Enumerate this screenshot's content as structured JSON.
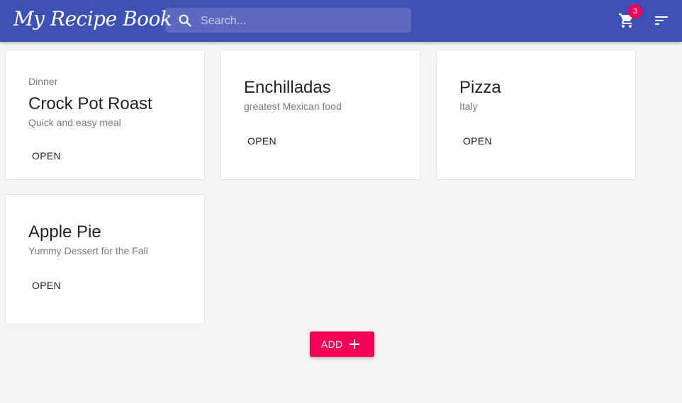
{
  "appbar": {
    "title": "My Recipe Book",
    "search": {
      "placeholder": "Search...",
      "value": ""
    },
    "cart": {
      "icon": "cart-icon",
      "count": "3"
    },
    "sort": {
      "icon": "sort-icon"
    },
    "color": "#3f51b5",
    "accent": "#f50057"
  },
  "recipes": [
    {
      "category": "Dinner",
      "title": "Crock Pot Roast",
      "description": "Quick and easy meal",
      "action": "OPEN"
    },
    {
      "category": "",
      "title": "Enchilladas",
      "description": "greatest Mexican food",
      "action": "OPEN"
    },
    {
      "category": "",
      "title": "Pizza",
      "description": "Italy",
      "action": "OPEN"
    },
    {
      "category": "",
      "title": "Apple Pie",
      "description": "Yummy Dessert for the Fall",
      "action": "OPEN"
    }
  ],
  "add_button": {
    "label": "ADD",
    "icon": "plus-icon"
  }
}
